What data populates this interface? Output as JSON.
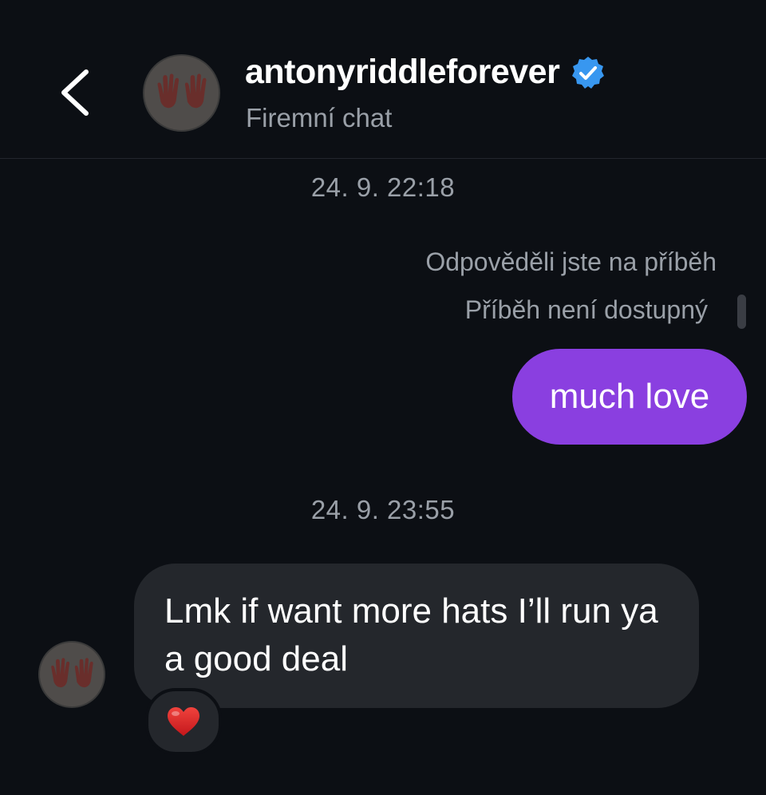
{
  "header": {
    "username": "antonyriddleforever",
    "subtitle": "Firemní chat",
    "verified": true
  },
  "messages": {
    "timestamp_1": "24. 9. 22:18",
    "story_reply_note": "Odpověděli jste na příběh",
    "story_unavailable": "Příběh není dostupný",
    "outgoing_text": "much love",
    "timestamp_2": "24. 9. 23:55",
    "incoming_text": "Lmk if want more hats I’ll run ya a good deal",
    "reaction": "heart"
  },
  "colors": {
    "background": "#0c0f14",
    "outgoing_bubble": "#8a3fe0",
    "incoming_bubble": "#24272c",
    "secondary_text": "#9aa0a8",
    "verified_badge": "#3897f0"
  },
  "icons": {
    "back": "chevron-left-icon",
    "verified": "verified-badge-icon",
    "reaction": "red-heart-icon"
  }
}
